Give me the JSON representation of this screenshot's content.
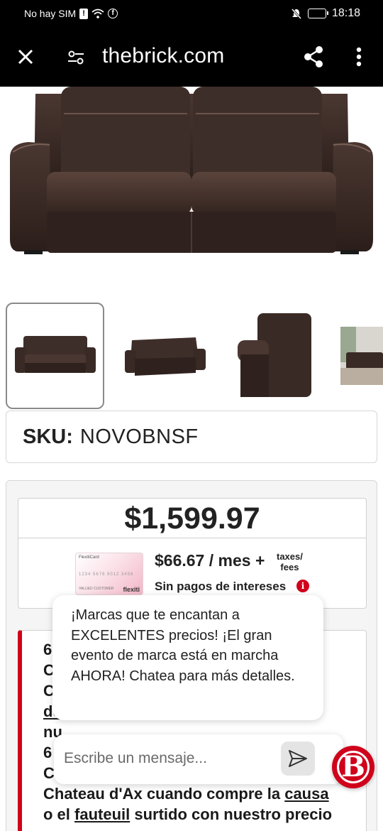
{
  "status_bar": {
    "carrier": "No hay SIM",
    "time": "18:18",
    "icons": [
      "sim-alert-icon",
      "wifi-icon",
      "facebook-icon",
      "mute-icon",
      "battery-icon"
    ]
  },
  "browser": {
    "url": "thebrick.com",
    "icons": [
      "close-icon",
      "site-settings-icon",
      "share-icon",
      "more-vert-icon"
    ]
  },
  "product": {
    "sku_label": "SKU:",
    "sku_value": "NOVOBNSF",
    "price": "$1,599.97",
    "financing": {
      "card_top": "FlexitiCard",
      "card_number": "1234 5678 9012 3456",
      "card_name": "VALUED CUSTOMER",
      "card_brand": "flexiti",
      "monthly": "$66.67 / mes +",
      "taxes_line1": "taxes/",
      "taxes_line2": "fees",
      "no_interest": "Sin pagos de intereses"
    },
    "promo": {
      "line1": "6",
      "line2": "C",
      "line3": "C",
      "line4": "de",
      "line5": "nu",
      "line6": "6",
      "line7": "C",
      "line8_pre": "Chateau d'Ax cuando compre la ",
      "line8_link": "causa",
      "line9_pre": "o el ",
      "line9_link": "fauteuil",
      "line9_post": " surtido con nuestro precio"
    }
  },
  "chat": {
    "message": "¡Marcas que te encantan a EXCELENTES precios! ¡El gran evento de marca está en marcha AHORA! Chatea para más detalles.",
    "input_placeholder": "Escribe un mensaje...",
    "launcher_letter": "B"
  },
  "colors": {
    "brand_red": "#d0021b",
    "bar_black": "#000000"
  }
}
